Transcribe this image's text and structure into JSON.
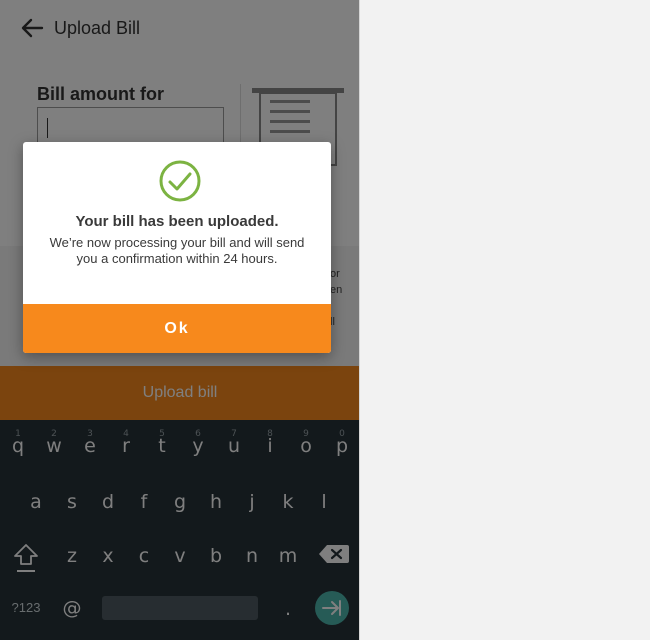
{
  "app_bar": {
    "title": "Upload Bill",
    "back_icon": "arrow-left-icon"
  },
  "form": {
    "label": "Bill amount for",
    "amount_value": ""
  },
  "side_text": [
    "or",
    "en",
    "ll"
  ],
  "upload_button": {
    "label": "Upload bill"
  },
  "dialog": {
    "icon": "check-circle-icon",
    "title": "Your bill has been uploaded.",
    "message": "We’re now processing your bill and will send you a confirmation within 24 hours.",
    "ok_label": "Ok"
  },
  "keyboard": {
    "row1": [
      {
        "key": "q",
        "hint": "1"
      },
      {
        "key": "w",
        "hint": "2"
      },
      {
        "key": "e",
        "hint": "3"
      },
      {
        "key": "r",
        "hint": "4"
      },
      {
        "key": "t",
        "hint": "5"
      },
      {
        "key": "y",
        "hint": "6"
      },
      {
        "key": "u",
        "hint": "7"
      },
      {
        "key": "i",
        "hint": "8"
      },
      {
        "key": "o",
        "hint": "9"
      },
      {
        "key": "p",
        "hint": "0"
      }
    ],
    "row2": [
      "a",
      "s",
      "d",
      "f",
      "g",
      "h",
      "j",
      "k",
      "l"
    ],
    "row3": [
      "z",
      "x",
      "c",
      "v",
      "b",
      "n",
      "m"
    ],
    "symbols_label": "?123",
    "at_label": "@",
    "period_label": ".",
    "shift_icon": "shift-icon",
    "backspace_icon": "backspace-icon",
    "enter_icon": "enter-next-icon"
  },
  "colors": {
    "accent": "#f7891c",
    "check": "#7cb342",
    "keyboard_bg": "#263238",
    "enter_key": "#4db6ac"
  }
}
